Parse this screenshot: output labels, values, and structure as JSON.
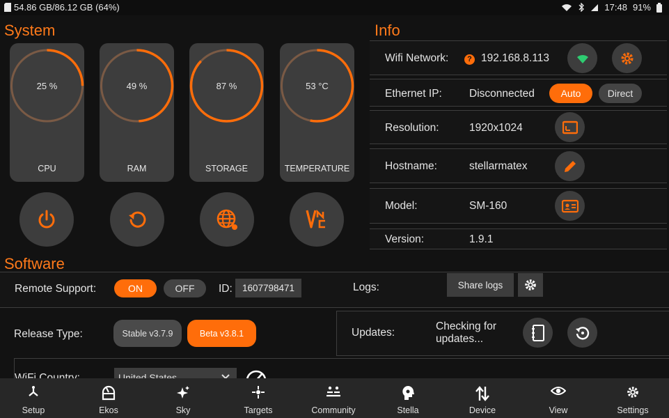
{
  "status_bar": {
    "storage_text": "54.86 GB/86.12 GB (64%)",
    "time": "17:48",
    "battery": "91%"
  },
  "system": {
    "title": "System",
    "gauges": [
      {
        "label": "CPU",
        "display": "25 %",
        "percent": 25
      },
      {
        "label": "RAM",
        "display": "49 %",
        "percent": 49
      },
      {
        "label": "STORAGE",
        "display": "87 %",
        "percent": 87
      },
      {
        "label": "TEMPERATURE",
        "display": "53 °C",
        "percent": 53
      }
    ],
    "actions": [
      "power-icon",
      "restart-icon",
      "web-icon",
      "vnc-icon"
    ]
  },
  "info": {
    "title": "Info",
    "wifi": {
      "label": "Wifi Network:",
      "value": "192.168.8.113",
      "status_icon": "?"
    },
    "ethernet": {
      "label": "Ethernet IP:",
      "value": "Disconnected",
      "auto_label": "Auto",
      "direct_label": "Direct",
      "selected": "Auto"
    },
    "resolution": {
      "label": "Resolution:",
      "value": "1920x1024"
    },
    "hostname": {
      "label": "Hostname:",
      "value": "stellarmatex"
    },
    "model": {
      "label": "Model:",
      "value": "SM-160"
    },
    "version": {
      "label": "Version:",
      "value": "1.9.1"
    }
  },
  "software": {
    "title": "Software",
    "remote_support": {
      "label": "Remote Support:",
      "on_label": "ON",
      "off_label": "OFF",
      "selected": "ON",
      "id_label": "ID:",
      "id_value": "1607798471"
    },
    "logs": {
      "label": "Logs:",
      "share_label": "Share logs"
    },
    "release": {
      "label": "Release Type:",
      "stable_label": "Stable v3.7.9",
      "beta_label": "Beta v3.8.1",
      "selected": "Beta v3.8.1"
    },
    "updates": {
      "label": "Updates:",
      "status_line1": "Checking for",
      "status_line2": "updates..."
    },
    "wifi_country": {
      "label": "WiFi Country:",
      "value": "United States"
    }
  },
  "nav": {
    "items": [
      {
        "label": "Setup",
        "icon": "setup-icon"
      },
      {
        "label": "Ekos",
        "icon": "ekos-icon"
      },
      {
        "label": "Sky",
        "icon": "sky-icon"
      },
      {
        "label": "Targets",
        "icon": "targets-icon"
      },
      {
        "label": "Community",
        "icon": "community-icon"
      },
      {
        "label": "Stella",
        "icon": "stella-icon"
      },
      {
        "label": "Device",
        "icon": "device-icon"
      },
      {
        "label": "View",
        "icon": "view-icon"
      },
      {
        "label": "Settings",
        "icon": "settings-icon"
      }
    ]
  },
  "colors": {
    "accent": "#ff6d0a",
    "track": "#7a5a45",
    "card": "#3d3d3d",
    "background": "#121212",
    "wifi_green": "#2ecc71"
  }
}
